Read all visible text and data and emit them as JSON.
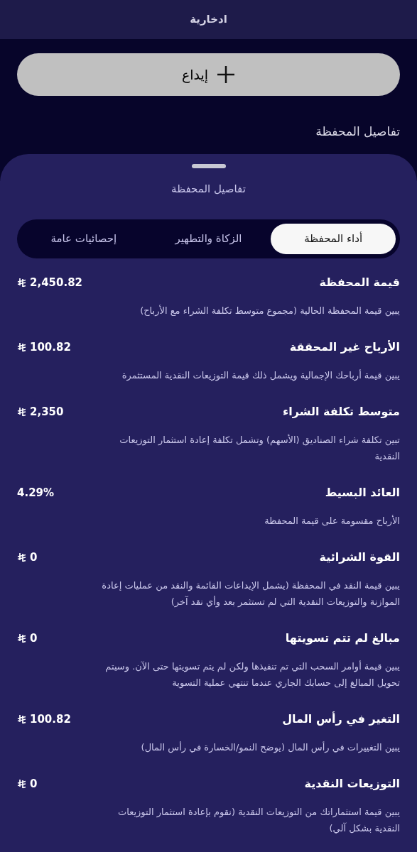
{
  "header": {
    "title": "ادخارية"
  },
  "deposit_button": {
    "label": "إيداع"
  },
  "section_title": "تفاصيل المحفظة",
  "sheet": {
    "title": "تفاصيل المحفظة",
    "tabs": [
      {
        "label": "أداء المحفظة",
        "selected": true
      },
      {
        "label": "الزكاة والتطهير",
        "selected": false
      },
      {
        "label": "إحصائيات عامة",
        "selected": false
      }
    ],
    "metrics": [
      {
        "title": "قيمة المحفظة",
        "value": "2,450.82",
        "currency": true,
        "description": "يبين قيمة المحفظة الحالية (مجموع متوسط تكلفة الشراء مع الأرباح)"
      },
      {
        "title": "الأرباح غير المحققة",
        "value": "100.82",
        "currency": true,
        "description": "يبين قيمة أرباحك الإجمالية ويشمل ذلك قيمة التوزيعات النقدية المستثمرة"
      },
      {
        "title": "متوسط تكلفة الشراء",
        "value": "2,350",
        "currency": true,
        "description": "تبين تكلفة شراء الصناديق (الأسهم) وتشمل تكلفة إعادة استثمار التوزيعات النقدية"
      },
      {
        "title": "العائد البسيط",
        "value": "4.29%",
        "currency": false,
        "description": "الأرباح مقسومة على قيمة المحفظة"
      },
      {
        "title": "القوة الشرائية",
        "value": "0",
        "currency": true,
        "description": "يبين قيمة النقد في المحفظة (يشمل الإيداعات القائمة والنقد من عمليات إعادة الموازنة والتوزيعات النقدية التي لم تستثمر بعد وأي نقد آخر)"
      },
      {
        "title": "مبالغ لم تتم تسويتها",
        "value": "0",
        "currency": true,
        "description": "يبين قيمة أوامر السحب التي تم تنفيذها ولكن لم يتم تسويتها حتى الآن. وسيتم تحويل المبالغ إلى حسابك الجاري عندما تنتهي عملية التسوية"
      },
      {
        "title": "التغير في رأس المال",
        "value": "100.82",
        "currency": true,
        "description": "يبين التغييرات في رأس المال (يوضح النمو/الخسارة في رأس المال)"
      },
      {
        "title": "التوزيعات النقدية",
        "value": "0",
        "currency": true,
        "description": "يبين قيمة استثماراتك من التوزيعات النقدية (نقوم بإعادة استثمار التوزيعات النقدية بشكل آلي)"
      }
    ]
  }
}
